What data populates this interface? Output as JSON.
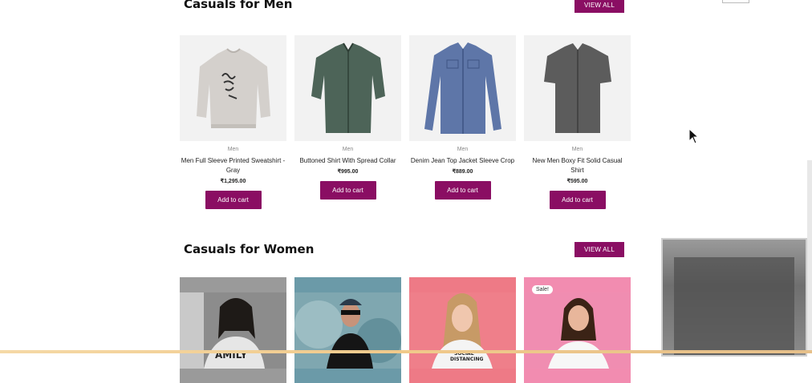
{
  "men_section": {
    "title": "Casuals for Men",
    "view_all": "VIEW ALL",
    "products": [
      {
        "category": "Men",
        "name": "Men Full Sleeve Printed Sweatshirt - Gray",
        "price": "₹1,295.00",
        "button": "Add to cart",
        "image": "sweatshirt-image"
      },
      {
        "category": "Men",
        "name": "Buttoned Shirt With Spread Collar",
        "price": "₹995.00",
        "button": "Add to cart",
        "image": "green-shirt-image"
      },
      {
        "category": "Men",
        "name": "Denim Jean Top Jacket Sleeve Crop",
        "price": "₹889.00",
        "button": "Add to cart",
        "image": "denim-shirt-image"
      },
      {
        "category": "Men",
        "name": "New Men Boxy Fit Solid Casual Shirt",
        "price": "₹595.00",
        "button": "Add to cart",
        "image": "grey-shirt-image"
      }
    ]
  },
  "women_section": {
    "title": "Casuals for Women",
    "view_all": "VIEW ALL",
    "sale_badge": "Sale!"
  },
  "colors": {
    "accent": "#8a0e63"
  }
}
